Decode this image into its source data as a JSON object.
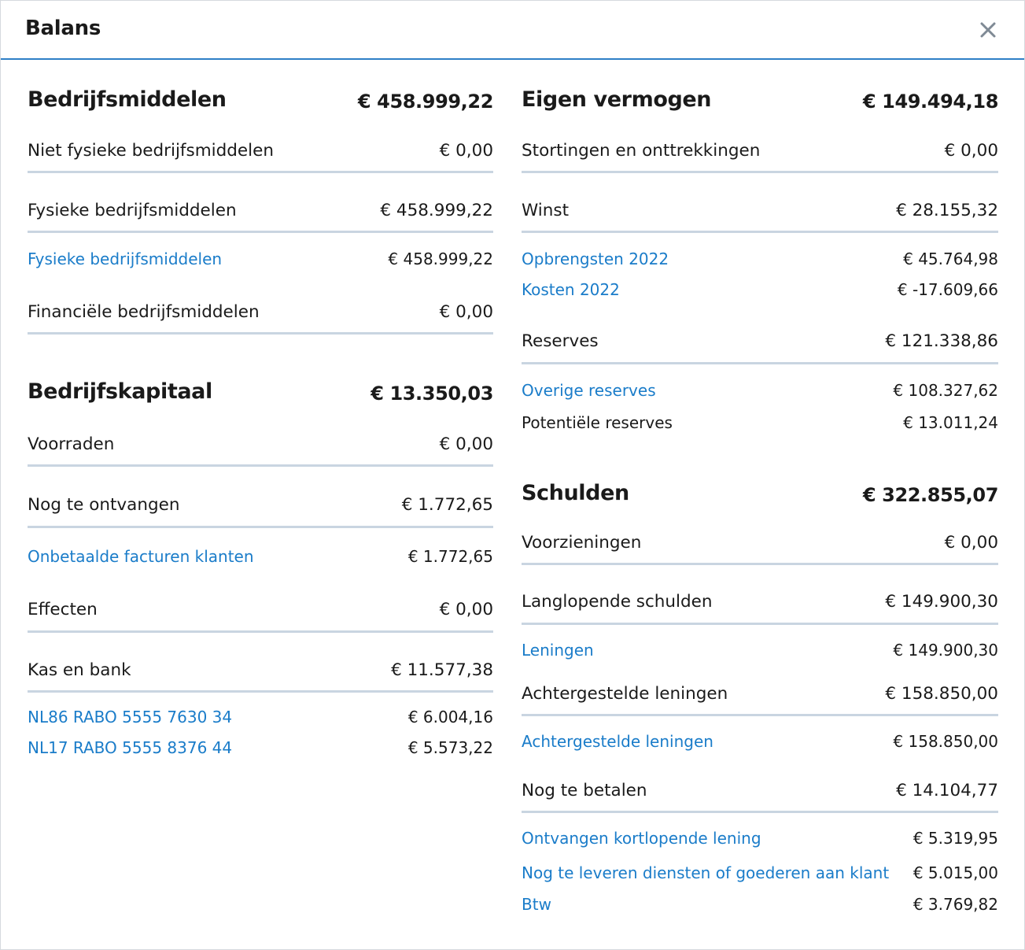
{
  "dialog": {
    "title": "Balans",
    "close_icon": "close-icon"
  },
  "left": {
    "bedrijfsmiddelen": {
      "title": "Bedrijfsmiddelen",
      "total": "€ 458.999,22",
      "rows": {
        "niet_fysiek": {
          "label": "Niet fysieke bedrijfsmiddelen",
          "value": "€ 0,00"
        },
        "fysiek": {
          "label": "Fysieke bedrijfsmiddelen",
          "value": "€ 458.999,22"
        },
        "fysiek_detail": {
          "label": "Fysieke bedrijfsmiddelen",
          "value": "€ 458.999,22"
        },
        "financieel": {
          "label": "Financiële bedrijfsmiddelen",
          "value": "€ 0,00"
        }
      }
    },
    "bedrijfskapitaal": {
      "title": "Bedrijfskapitaal",
      "total": "€ 13.350,03",
      "rows": {
        "voorraden": {
          "label": "Voorraden",
          "value": "€ 0,00"
        },
        "nog_te_ontvangen": {
          "label": "Nog te ontvangen",
          "value": "€ 1.772,65"
        },
        "onbetaalde_facturen": {
          "label": "Onbetaalde facturen klanten",
          "value": "€ 1.772,65"
        },
        "effecten": {
          "label": "Effecten",
          "value": "€ 0,00"
        },
        "kas_en_bank": {
          "label": "Kas en bank",
          "value": "€ 11.577,38"
        },
        "bank1": {
          "label": "NL86 RABO 5555 7630 34",
          "value": "€ 6.004,16"
        },
        "bank2": {
          "label": "NL17 RABO 5555 8376 44",
          "value": "€ 5.573,22"
        }
      }
    }
  },
  "right": {
    "eigen_vermogen": {
      "title": "Eigen vermogen",
      "total": "€ 149.494,18",
      "rows": {
        "stortingen": {
          "label": "Stortingen en onttrekkingen",
          "value": "€ 0,00"
        },
        "winst": {
          "label": "Winst",
          "value": "€ 28.155,32"
        },
        "opbrengsten": {
          "label": "Opbrengsten 2022",
          "value": "€ 45.764,98"
        },
        "kosten": {
          "label": "Kosten 2022",
          "value": "€ -17.609,66"
        },
        "reserves": {
          "label": "Reserves",
          "value": "€ 121.338,86"
        },
        "overige_reserves": {
          "label": "Overige reserves",
          "value": "€ 108.327,62"
        },
        "potentiele_reserves": {
          "label": "Potentiële reserves",
          "value": "€ 13.011,24"
        }
      }
    },
    "schulden": {
      "title": "Schulden",
      "total": "€ 322.855,07",
      "rows": {
        "voorzieningen": {
          "label": "Voorzieningen",
          "value": "€ 0,00"
        },
        "langlopend": {
          "label": "Langlopende schulden",
          "value": "€ 149.900,30"
        },
        "leningen": {
          "label": "Leningen",
          "value": "€ 149.900,30"
        },
        "achtergesteld": {
          "label": "Achtergestelde leningen",
          "value": "€ 158.850,00"
        },
        "achtergesteld_detail": {
          "label": "Achtergestelde leningen",
          "value": "€ 158.850,00"
        },
        "nog_te_betalen": {
          "label": "Nog te betalen",
          "value": "€ 14.104,77"
        },
        "kortlopende_lening": {
          "label": "Ontvangen kortlopende lening",
          "value": "€ 5.319,95"
        },
        "nog_te_leveren": {
          "label": "Nog te leveren diensten of goederen aan klant",
          "value": "€ 5.015,00"
        },
        "btw": {
          "label": "Btw",
          "value": "€ 3.769,82"
        }
      }
    }
  }
}
